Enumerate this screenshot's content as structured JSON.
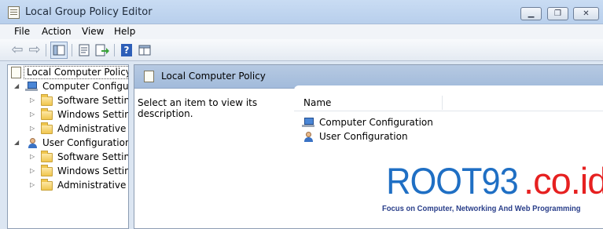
{
  "window": {
    "title": "Local Group Policy Editor",
    "controls": {
      "minimize": "▁",
      "maximize": "❐",
      "close": "✕"
    }
  },
  "menu": [
    "File",
    "Action",
    "View",
    "Help"
  ],
  "toolbar": {
    "icons": [
      "back-icon",
      "forward-icon",
      "show-hide-tree-icon",
      "properties-icon",
      "export-list-icon",
      "help-icon",
      "view-icon"
    ],
    "help_glyph": "?"
  },
  "tree": {
    "root": "Local Computer Policy",
    "nodes": [
      {
        "label": "Computer Configura",
        "children": [
          "Software Settings",
          "Windows Setting",
          "Administrative Te"
        ]
      },
      {
        "label": "User Configuration",
        "children": [
          "Software Settings",
          "Windows Setting",
          "Administrative Te"
        ]
      }
    ]
  },
  "details": {
    "header_title": "Local Computer Policy",
    "description": "Select an item to view its description.",
    "column_name": "Name",
    "items": [
      "Computer Configuration",
      "User Configuration"
    ]
  },
  "watermark": {
    "logo_main": "ROOT93",
    "logo_suffix": ".co.id",
    "tagline": "Focus on Computer, Networking And Web Programming"
  },
  "colors": {
    "accent_header": "#a2bbdb",
    "logo_blue": "#1f6fc4",
    "logo_red": "#e62020"
  }
}
